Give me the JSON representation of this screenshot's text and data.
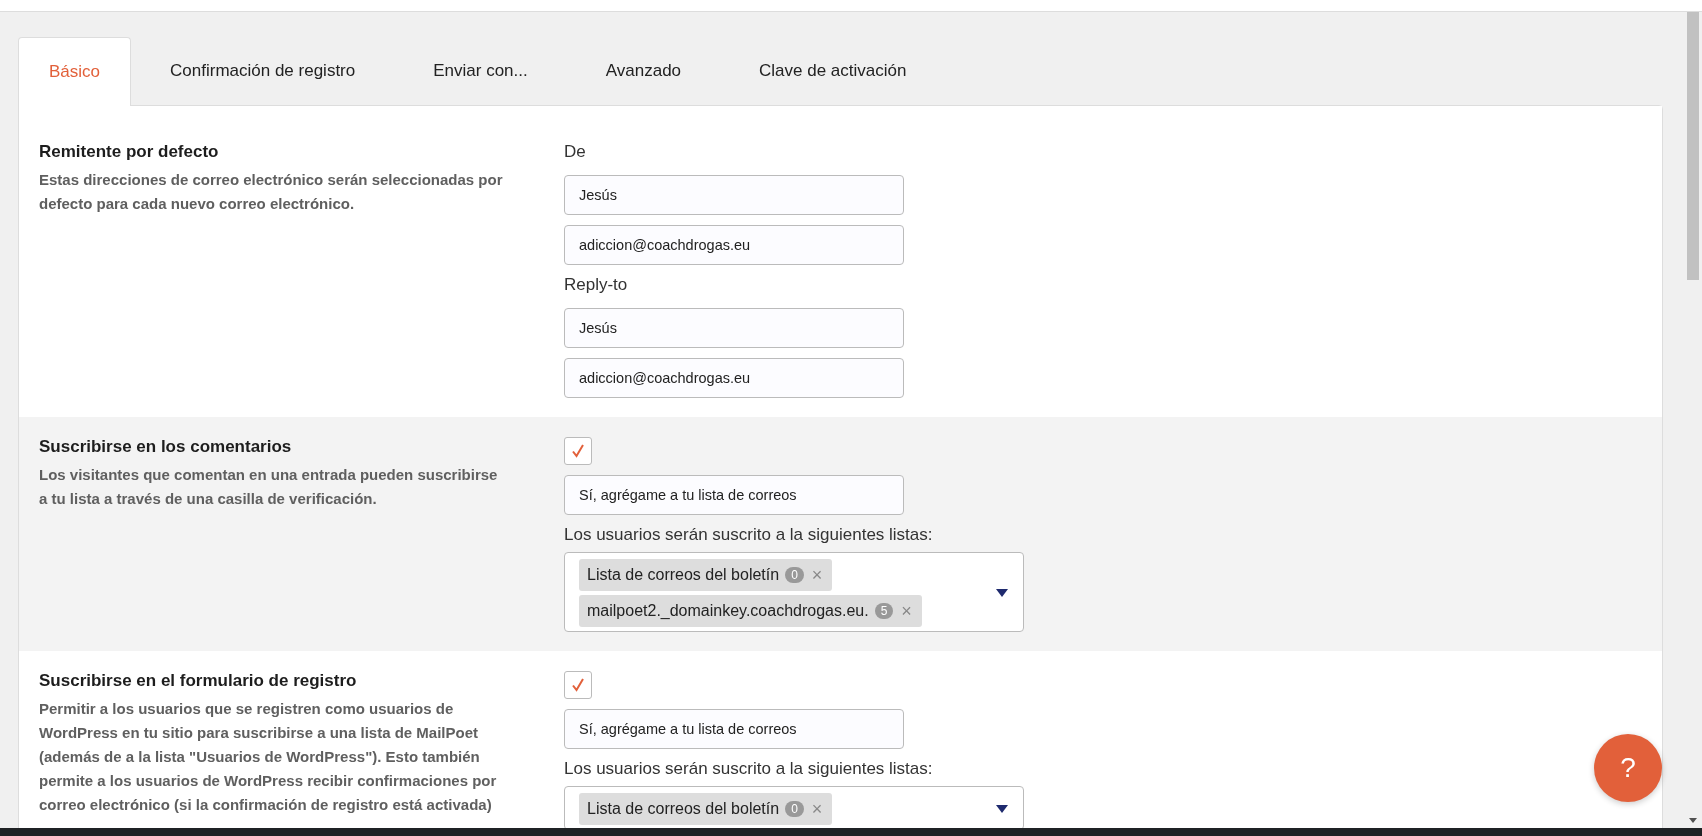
{
  "tabs": [
    {
      "label": "Básico",
      "selected": true
    },
    {
      "label": "Confirmación de registro",
      "selected": false
    },
    {
      "label": "Enviar con...",
      "selected": false
    },
    {
      "label": "Avanzado",
      "selected": false
    },
    {
      "label": "Clave de activación",
      "selected": false
    }
  ],
  "sections": [
    {
      "title": "Remitente por defecto",
      "description": "Estas direcciones de correo electrónico serán seleccionadas por defecto para cada nuevo correo electrónico.",
      "controls": [
        {
          "kind": "label",
          "text": "De"
        },
        {
          "kind": "input",
          "value": "Jesús"
        },
        {
          "kind": "input",
          "value": "adiccion@coachdrogas.eu"
        },
        {
          "kind": "label",
          "text": "Reply-to"
        },
        {
          "kind": "input",
          "value": "Jesús"
        },
        {
          "kind": "input",
          "value": "adiccion@coachdrogas.eu"
        }
      ]
    },
    {
      "title": "Suscribirse en los comentarios",
      "description": "Los visitantes que comentan en una entrada pueden suscribirse a tu lista a través de una casilla de verificación.",
      "controls": [
        {
          "kind": "checkbox",
          "checked": true
        },
        {
          "kind": "input",
          "value": "Sí, agrégame a tu lista de correos"
        },
        {
          "kind": "label",
          "text": "Los usuarios serán suscrito a la siguientes listas:"
        },
        {
          "kind": "multiselect",
          "tags": [
            {
              "text": "Lista de correos del boletín",
              "count": "0",
              "remove": "×"
            },
            {
              "text": "mailpoet2._domainkey.coachdrogas.eu.",
              "count": "5",
              "remove": "×"
            }
          ]
        }
      ]
    },
    {
      "title": "Suscribirse en el formulario de registro",
      "description": "Permitir a los usuarios que se registren como usuarios de WordPress en tu sitio para suscribirse a una lista de MailPoet (además de a la lista \"Usuarios de WordPress\"). Esto también permite a los usuarios de WordPress recibir confirmaciones por correo electrónico (si la confirmación de registro está activada)",
      "controls": [
        {
          "kind": "checkbox",
          "checked": true
        },
        {
          "kind": "input",
          "value": "Sí, agrégame a tu lista de correos"
        },
        {
          "kind": "label",
          "text": "Los usuarios serán suscrito a la siguientes listas:"
        },
        {
          "kind": "multiselect",
          "tags": [
            {
              "text": "Lista de correos del boletín",
              "count": "0",
              "remove": "×"
            }
          ]
        }
      ]
    }
  ],
  "help_button": {
    "label": "?"
  }
}
